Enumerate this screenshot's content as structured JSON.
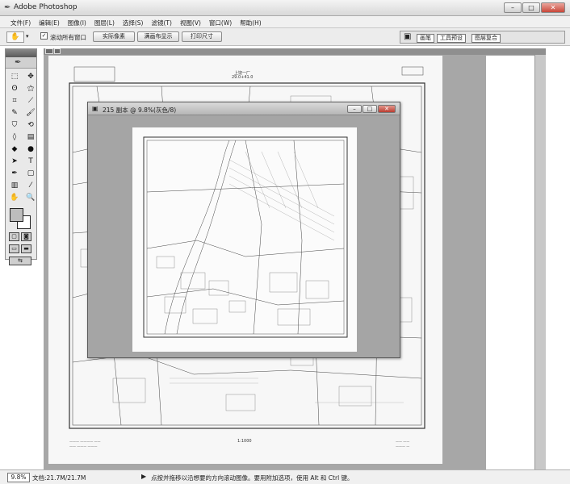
{
  "window": {
    "title": "Adobe Photoshop",
    "buttons": [
      "–",
      "□",
      "✕"
    ]
  },
  "menubar": [
    "文件(F)",
    "编辑(E)",
    "图像(I)",
    "图层(L)",
    "选择(S)",
    "滤镜(T)",
    "视图(V)",
    "窗口(W)",
    "帮助(H)"
  ],
  "options": {
    "tool_icon": "hand-icon",
    "scroll_all_label": "滚动所有窗口",
    "scroll_all_checked": true,
    "btn_actual": "实际像素",
    "btn_fit": "满画布显示",
    "btn_print": "打印尺寸",
    "panel_tabs": [
      "画笔",
      "工具预设",
      "图层复合"
    ]
  },
  "document_main": {
    "map_title": "上饶一厂",
    "map_subtitle": "29.0+41.0",
    "scale_label": "1:1000"
  },
  "document_float": {
    "title": "215 副本 @ 9.8%(灰色/8)",
    "buttons": [
      "–",
      "□",
      "✕"
    ]
  },
  "status": {
    "zoom": "9.8%",
    "doc_size": "文档:21.7M/21.7M",
    "hint": "点按并拖移以沿想要的方向滚动图像。要用附加选项，使用 Alt 和 Ctrl 键。"
  }
}
